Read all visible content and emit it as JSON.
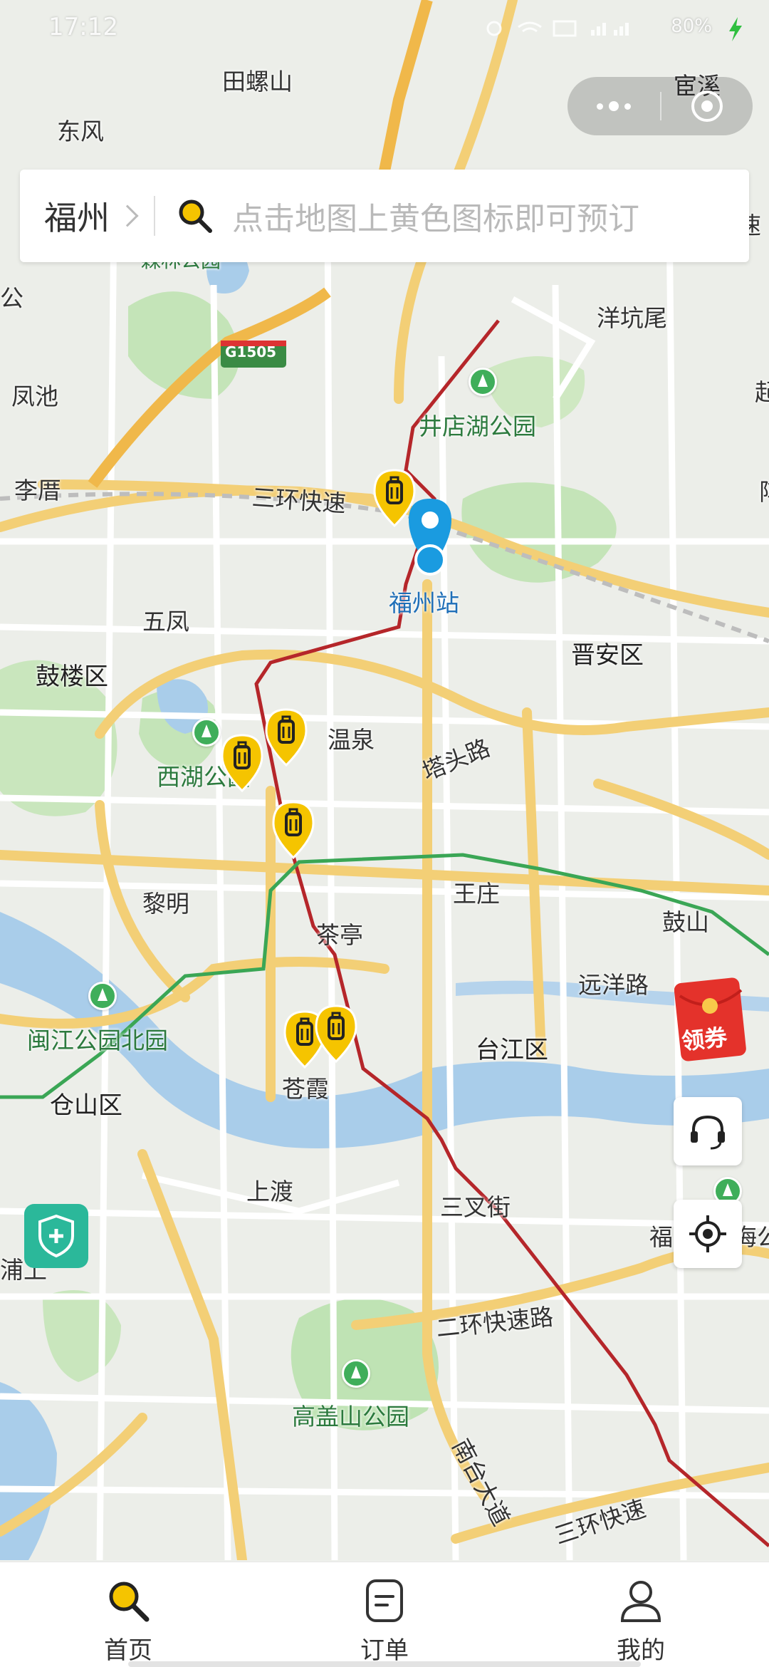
{
  "status_bar": {
    "time": "17:12",
    "battery": "80%"
  },
  "capsule": {
    "more_icon": "more-dots-icon",
    "close_icon": "close-target-icon"
  },
  "search": {
    "city": "福州",
    "placeholder": "点击地图上黄色图标即可预订"
  },
  "map": {
    "road_badge": "G1505",
    "labels": {
      "tianluoshan": "田螺山",
      "dongfeng": "东风",
      "huanxi": "宦溪",
      "senlin_park": "森林公园",
      "gong": "公",
      "yangkengwei": "洋坑尾",
      "fengchi": "凤池",
      "jingdianhu": "井店湖公园",
      "lishu": "李厝",
      "sanhuan_kuaisu": "三环快速",
      "fuzhou_station": "福州站",
      "wufeng": "五凤",
      "gulou": "鼓楼区",
      "jinan": "晋安区",
      "wenquan": "温泉",
      "tatoulu": "塔头路",
      "xihu_park": "西湖公园",
      "wangzhuang": "王庄",
      "liming": "黎明",
      "gushan": "鼓山",
      "chating": "茶亭",
      "yuanyanglu": "远洋路",
      "minjiang_park": "闽江公园北园",
      "taijiang": "台江区",
      "cangshan": "仓山区",
      "cangxia": "苍霞",
      "shangdu": "上渡",
      "sanchajie": "三叉街",
      "pushang": "浦上",
      "fu_edge": "福",
      "haigong": "海公",
      "erhuan": "二环快速路",
      "gaogaishan": "高盖山公园",
      "nantai": "南台大道",
      "sanhuan_bottom": "三环快速",
      "su_edge": "速",
      "qi_edge": "起",
      "zhen_edge": "阵"
    }
  },
  "floating": {
    "coupon_label": "领券",
    "service_icon": "headset-icon",
    "locate_icon": "locate-icon",
    "shield_icon": "shield-plus-icon"
  },
  "tabs": [
    {
      "label": "首页",
      "icon": "search-icon",
      "active": true
    },
    {
      "label": "订单",
      "icon": "order-icon",
      "active": false
    },
    {
      "label": "我的",
      "icon": "profile-icon",
      "active": false
    }
  ],
  "colors": {
    "accent": "#f5c400",
    "metro_red": "#b5262a",
    "metro_green": "#3aa655",
    "river": "#a9cdea",
    "park": "#bfe3b4",
    "main_road": "#f6d684"
  }
}
